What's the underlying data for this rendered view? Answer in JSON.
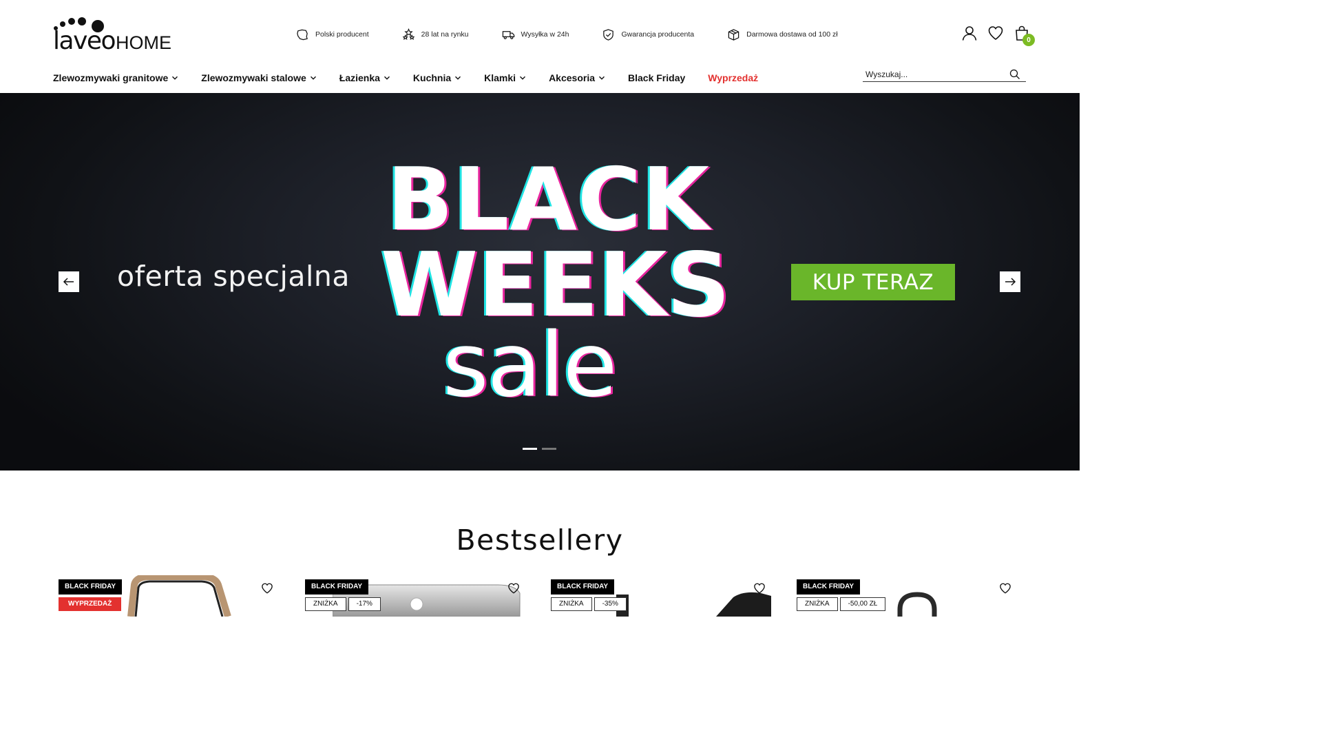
{
  "brand": {
    "logo_main": "laveo",
    "logo_suffix": "HOME"
  },
  "usps": [
    {
      "icon": "poland-map-icon",
      "label": "Polski producent"
    },
    {
      "icon": "stars-icon",
      "label": "28 lat na rynku"
    },
    {
      "icon": "truck-icon",
      "label": "Wysyłka w 24h"
    },
    {
      "icon": "shield-check-icon",
      "label": "Gwarancja producenta"
    },
    {
      "icon": "package-icon",
      "label": "Darmowa dostawa od 100 zł"
    }
  ],
  "header_icons": {
    "account": "user-icon",
    "wishlist": "heart-icon",
    "cart": "cart-icon",
    "cart_count": "0"
  },
  "nav": [
    {
      "label": "Zlewozmywaki granitowe",
      "has_dropdown": true
    },
    {
      "label": "Zlewozmywaki stalowe",
      "has_dropdown": true
    },
    {
      "label": "Łazienka",
      "has_dropdown": true
    },
    {
      "label": "Kuchnia",
      "has_dropdown": true
    },
    {
      "label": "Klamki",
      "has_dropdown": true
    },
    {
      "label": "Akcesoria",
      "has_dropdown": true
    },
    {
      "label": "Black Friday",
      "has_dropdown": false
    },
    {
      "label": "Wyprzedaż",
      "has_dropdown": false,
      "color": "#e3312f"
    }
  ],
  "search": {
    "placeholder": "Wyszukaj..."
  },
  "hero": {
    "subtitle": "oferta specjalna",
    "line1": "BLACK",
    "line2": "WEEKS",
    "line3": "sale",
    "cta": "KUP TERAZ",
    "slides_total": 2,
    "active_slide": 1
  },
  "section": {
    "title": "Bestsellery"
  },
  "products": [
    {
      "badge": "BLACK FRIDAY",
      "tags": [],
      "sale_tag": "WYPRZEDAŻ"
    },
    {
      "badge": "BLACK FRIDAY",
      "tags": [
        "ZNIŻKA",
        "-17%"
      ],
      "sale_tag": ""
    },
    {
      "badge": "BLACK FRIDAY",
      "tags": [
        "ZNIŻKA",
        "-35%"
      ],
      "sale_tag": ""
    },
    {
      "badge": "BLACK FRIDAY",
      "tags": [
        "ZNIŻKA",
        "-50,00 ZŁ"
      ],
      "sale_tag": ""
    }
  ],
  "colors": {
    "accent_green": "#6ab62a",
    "cart_badge": "#7cbb23",
    "sale_red": "#e3312f"
  }
}
